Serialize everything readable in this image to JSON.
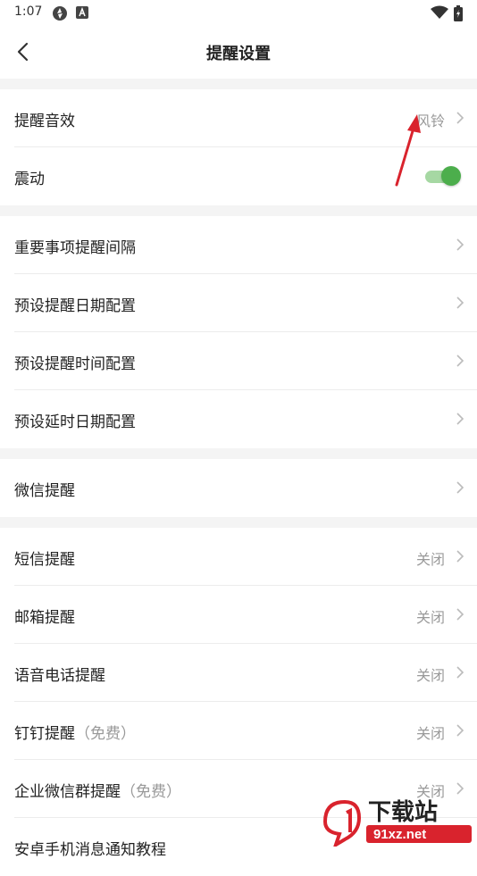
{
  "status": {
    "time": "1:07"
  },
  "header": {
    "title": "提醒设置"
  },
  "groups": [
    {
      "rows": [
        {
          "label": "提醒音效",
          "value": "风铃"
        },
        {
          "label": "震动",
          "toggle": true
        }
      ]
    },
    {
      "rows": [
        {
          "label": "重要事项提醒间隔"
        },
        {
          "label": "预设提醒日期配置"
        },
        {
          "label": "预设提醒时间配置"
        },
        {
          "label": "预设延时日期配置"
        }
      ]
    },
    {
      "rows": [
        {
          "label": "微信提醒"
        }
      ]
    },
    {
      "rows": [
        {
          "label": "短信提醒",
          "value": "关闭"
        },
        {
          "label": "邮箱提醒",
          "value": "关闭"
        },
        {
          "label": "语音电话提醒",
          "value": "关闭"
        },
        {
          "label": "钉钉提醒",
          "sub": "（免费）",
          "value": "关闭"
        },
        {
          "label": "企业微信群提醒",
          "sub": "（免费）",
          "value": "关闭"
        },
        {
          "label": "安卓手机消息通知教程"
        }
      ]
    }
  ],
  "watermark": {
    "text1": "下载站",
    "text2": "91xz.net"
  },
  "colors": {
    "accent": "#4cae4c",
    "annotation": "#d9232d"
  }
}
